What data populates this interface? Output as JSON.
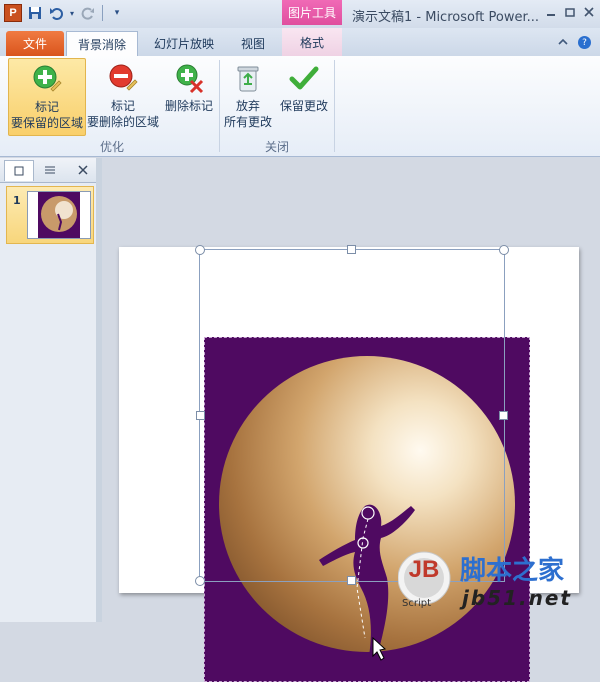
{
  "window": {
    "title": "演示文稿1 - Microsoft Power...",
    "app_icon_letter": "P",
    "context_header": "图片工具"
  },
  "tabs": {
    "file": "文件",
    "background_removal": "背景消除",
    "slideshow": "幻灯片放映",
    "view": "视图",
    "format": "格式"
  },
  "ribbon": {
    "mark_keep_line1": "标记",
    "mark_keep_line2": "要保留的区域",
    "mark_remove_line1": "标记",
    "mark_remove_line2": "要删除的区域",
    "delete_mark": "删除标记",
    "discard_line1": "放弃",
    "discard_line2": "所有更改",
    "keep_changes": "保留更改",
    "group_refine": "优化",
    "group_close": "关闭"
  },
  "slides_panel": {
    "slide_number": "1"
  },
  "watermark": {
    "logo": "JB",
    "logo_sub": "Script",
    "site_cn": "脚本之家",
    "site_en": "jb51.net"
  },
  "colors": {
    "accent_file": "#d9541c",
    "context_pink": "#e04e9e",
    "picture_bg": "#4f0a61",
    "selected_button": "#f9cf6b"
  }
}
